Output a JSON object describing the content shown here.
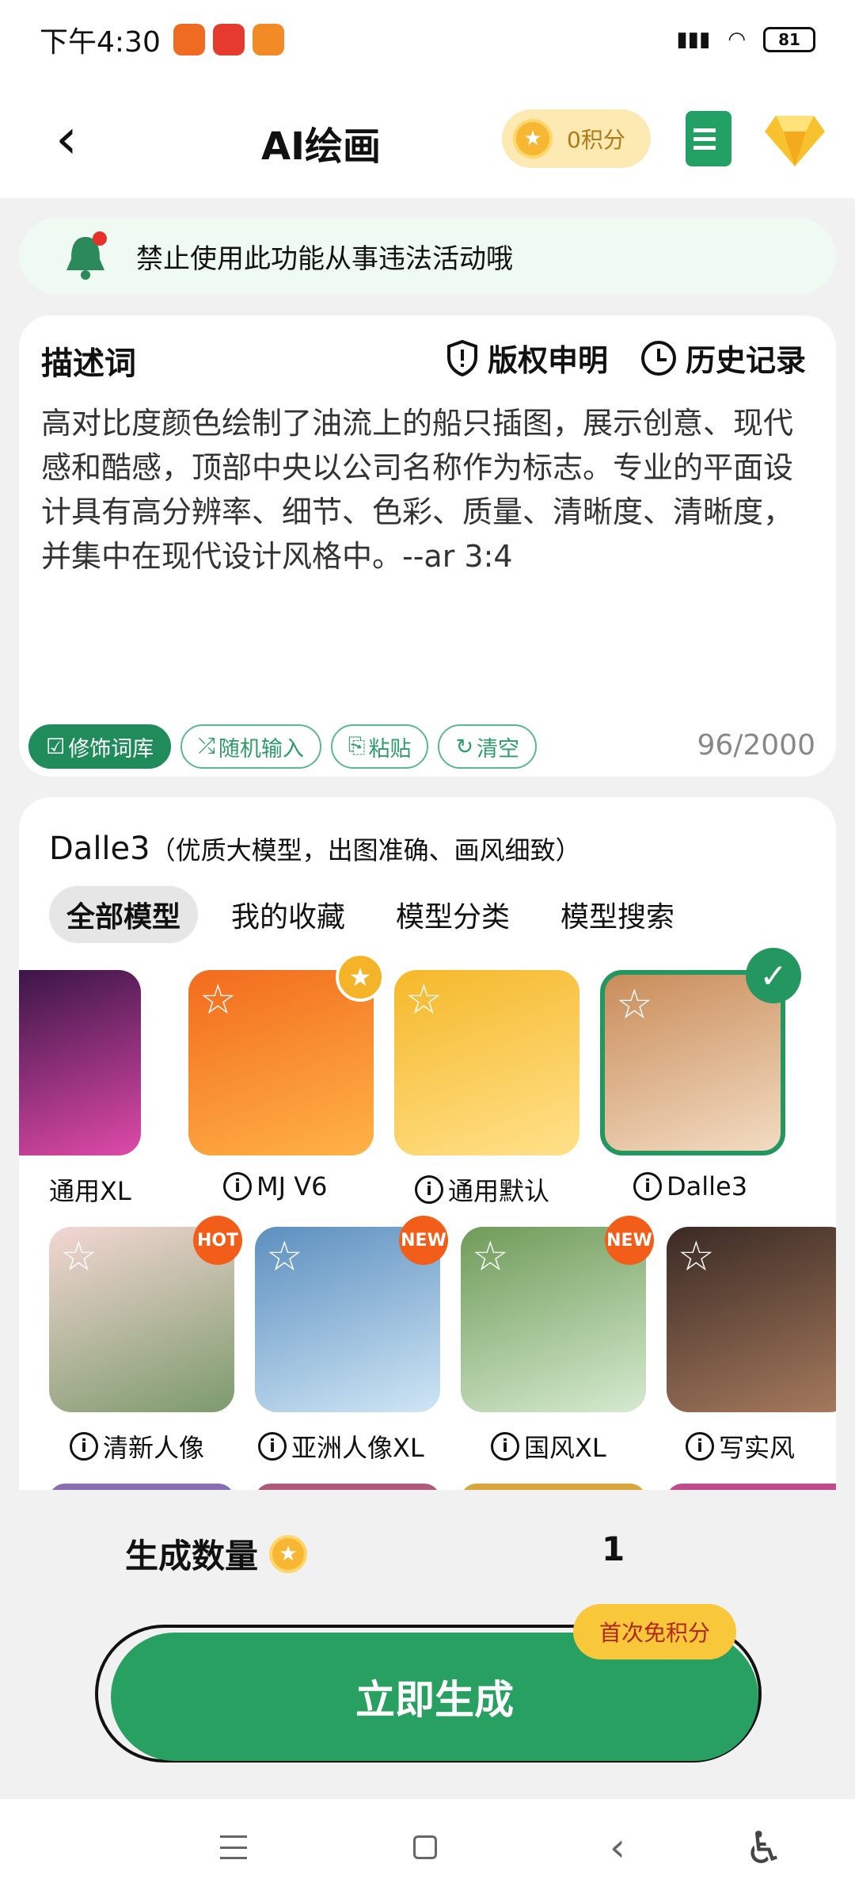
{
  "status_bar": {
    "time": "下午4:30",
    "battery": "81"
  },
  "header": {
    "title": "AI绘画",
    "points": "0积分"
  },
  "notice": {
    "text": "禁止使用此功能从事违法活动哦"
  },
  "prompt": {
    "label": "描述词",
    "copyright_label": "版权申明",
    "history_label": "历史记录",
    "text": "高对比度颜色绘制了油流上的船只插图，展示创意、现代感和酷感，顶部中央以公司名称作为标志。专业的平面设计具有高分辨率、细节、色彩、质量、清晰度、清晰度，并集中在现代设计风格中。--ar 3:4",
    "counter": "96/2000",
    "chips": [
      "修饰词库",
      "随机输入",
      "粘贴",
      "清空"
    ]
  },
  "models": {
    "title": "Dalle3",
    "subtitle": "（优质大模型，出图准确、画风细致）",
    "tabs": [
      "全部模型",
      "我的收藏",
      "模型分类",
      "模型搜索"
    ],
    "row1": [
      {
        "name": "通用XL",
        "color1": "#2a1040",
        "color2": "#e04aa8"
      },
      {
        "name": "MJ V6",
        "color1": "#f26b1d",
        "color2": "#ffb347",
        "badge": "★"
      },
      {
        "name": "通用默认",
        "color1": "#f5b82a",
        "color2": "#ffe18a"
      },
      {
        "name": "Dalle3",
        "color1": "#c98c5a",
        "color2": "#f2dcc2",
        "selected": true
      }
    ],
    "row2": [
      {
        "name": "清新人像",
        "color1": "#f3d7d3",
        "color2": "#7c9a6d",
        "badge": "HOT"
      },
      {
        "name": "亚洲人像XL",
        "color1": "#5c8fbf",
        "color2": "#cfe6f5",
        "badge": "NEW"
      },
      {
        "name": "国风XL",
        "color1": "#6f9b58",
        "color2": "#d6ead0",
        "badge": "NEW"
      },
      {
        "name": "写实风",
        "color1": "#3a2a24",
        "color2": "#a77b5e"
      }
    ]
  },
  "generate": {
    "quantity_label": "生成数量",
    "quantity_value": "1",
    "button_label": "立即生成",
    "free_badge": "首次免积分"
  }
}
